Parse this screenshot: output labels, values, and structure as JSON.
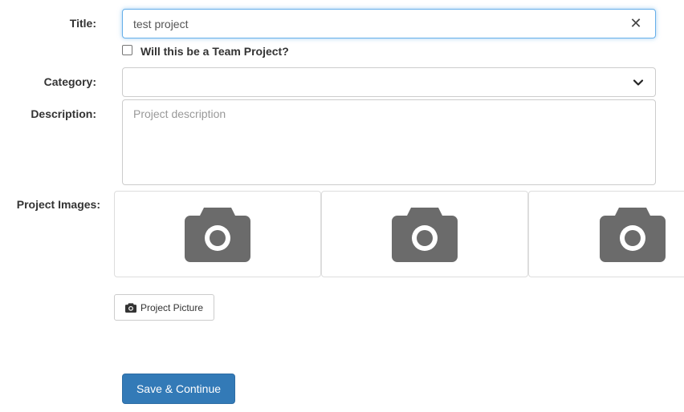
{
  "form": {
    "title": {
      "label": "Title:",
      "value": "test project",
      "clear_glyph": "✕"
    },
    "team": {
      "label": "Will this be a Team Project?",
      "checked": false
    },
    "category": {
      "label": "Category:",
      "selected": ""
    },
    "description": {
      "label": "Description:",
      "placeholder": "Project description",
      "value": ""
    },
    "images": {
      "label": "Project Images:",
      "slots": [
        {
          "icon": "camera-icon"
        },
        {
          "icon": "camera-icon"
        },
        {
          "icon": "camera-icon"
        }
      ]
    },
    "picture_button": {
      "label": "Project Picture",
      "icon": "camera-icon"
    },
    "save_button": {
      "label": "Save & Continue"
    }
  },
  "colors": {
    "primary": "#337ab7",
    "focus_border": "#66afe9",
    "camera_gray": "#6b6b6b",
    "label_text": "#333333"
  }
}
